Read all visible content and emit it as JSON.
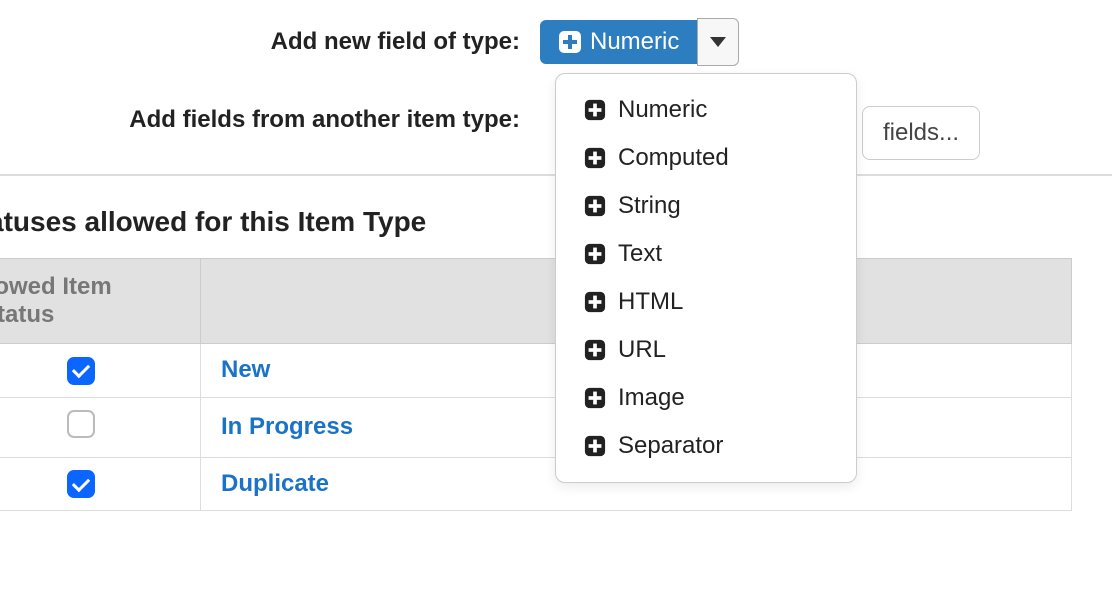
{
  "form": {
    "add_field_label": "Add new field of type:",
    "add_field_button": "Numeric",
    "import_label": "Add fields from another item type:",
    "import_button_suffix": "fields..."
  },
  "dropdown": {
    "items": [
      "Numeric",
      "Computed",
      "String",
      "Text",
      "HTML",
      "URL",
      "Image",
      "Separator"
    ]
  },
  "section": {
    "heading": "Statuses allowed for this Item Type"
  },
  "table": {
    "col_allowed": "llowed Item Status",
    "rows": [
      {
        "checked": true,
        "name": "New"
      },
      {
        "checked": false,
        "name": "In Progress"
      },
      {
        "checked": true,
        "name": "Duplicate"
      }
    ]
  }
}
